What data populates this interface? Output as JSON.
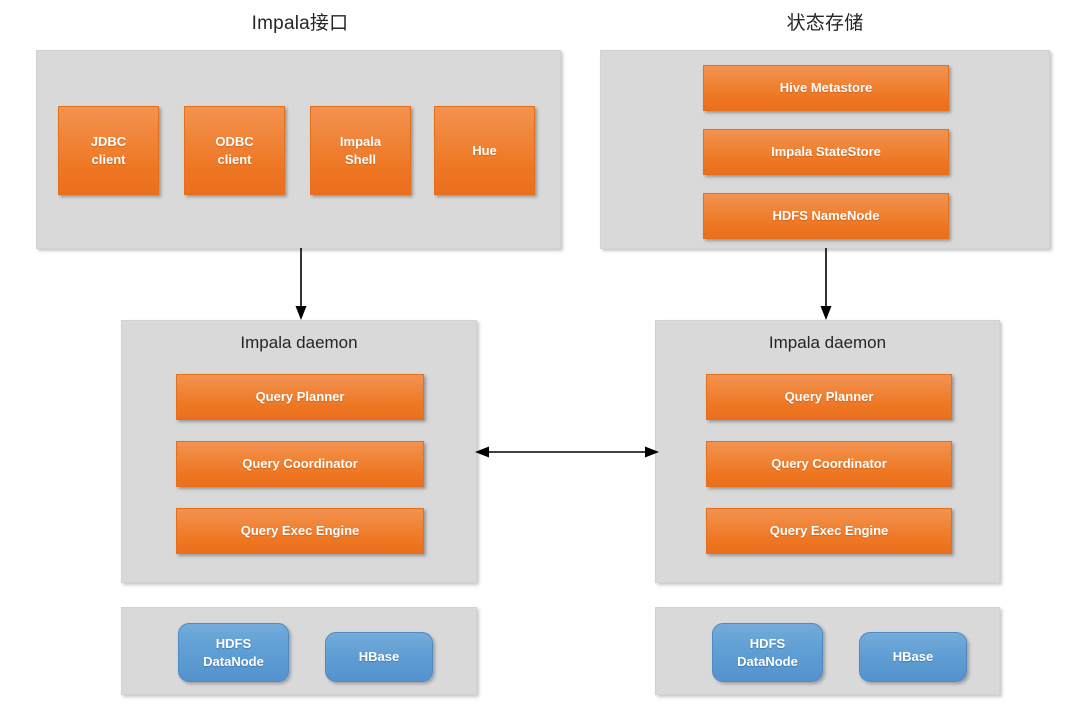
{
  "diagram": {
    "title_left": "Impala接口",
    "title_right": "状态存储",
    "colors": {
      "panel_gray": "#d9d9d9",
      "node_orange": "#ee7622",
      "node_blue": "#609fd4",
      "connector": "#000000",
      "text_dark": "#262626",
      "text_light": "#ffffff",
      "background": "#ffffff"
    },
    "interface_group": {
      "title": "Impala接口",
      "nodes": [
        {
          "line1": "JDBC",
          "line2": "client"
        },
        {
          "line1": "ODBC",
          "line2": "client"
        },
        {
          "line1": "Impala",
          "line2": "Shell"
        },
        {
          "line1": "Hue",
          "line2": ""
        }
      ]
    },
    "state_store_group": {
      "title": "状态存储",
      "nodes": [
        {
          "label": "Hive Metastore"
        },
        {
          "label": "Impala StateStore"
        },
        {
          "label": "HDFS NameNode"
        }
      ]
    },
    "daemon_left": {
      "heading": "Impala daemon",
      "nodes": [
        {
          "label": "Query Planner"
        },
        {
          "label": "Query Coordinator"
        },
        {
          "label": "Query Exec Engine"
        }
      ]
    },
    "daemon_right": {
      "heading": "Impala daemon",
      "nodes": [
        {
          "label": "Query Planner"
        },
        {
          "label": "Query Coordinator"
        },
        {
          "label": "Query Exec Engine"
        }
      ]
    },
    "storage_left": {
      "nodes": [
        {
          "line1": "HDFS",
          "line2": "DataNode"
        },
        {
          "line1": "HBase",
          "line2": ""
        }
      ]
    },
    "storage_right": {
      "nodes": [
        {
          "line1": "HDFS",
          "line2": "DataNode"
        },
        {
          "line1": "HBase",
          "line2": ""
        }
      ]
    },
    "connectors": [
      {
        "name": "interface-to-daemon-left",
        "kind": "arrow-down"
      },
      {
        "name": "statestore-to-daemon-right",
        "kind": "arrow-down"
      },
      {
        "name": "daemon-to-daemon",
        "kind": "arrow-bidirectional"
      }
    ]
  }
}
